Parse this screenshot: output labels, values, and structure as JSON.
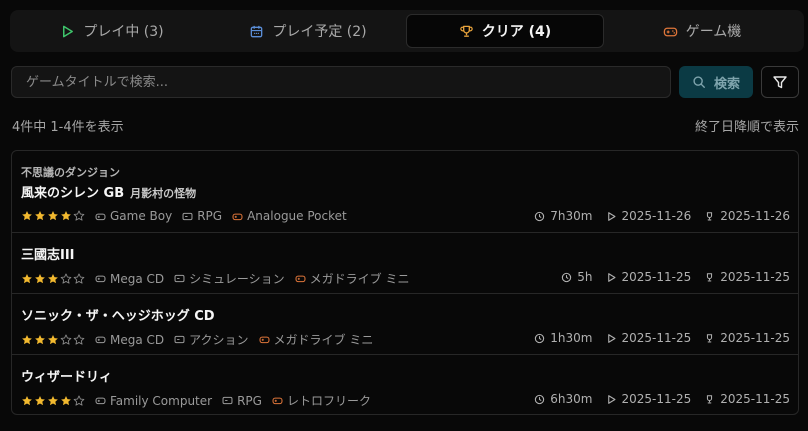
{
  "tabs": [
    {
      "label": "プレイ中 (3)",
      "icon": "play-icon",
      "color": "#3ec56b"
    },
    {
      "label": "プレイ予定 (2)",
      "icon": "calendar-icon",
      "color": "#5b8ed8"
    },
    {
      "label": "クリア (4)",
      "icon": "trophy-icon",
      "color": "#e8a33c",
      "active": true
    },
    {
      "label": "ゲーム機",
      "icon": "gamepad-icon",
      "color": "#e0763a"
    }
  ],
  "search": {
    "placeholder": "ゲームタイトルで検索...",
    "value": "",
    "button_label": "検索"
  },
  "results": {
    "count_text": "4件中 1-4件を表示",
    "sort_label": "終了日降順で表示"
  },
  "colors": {
    "star_filled": "#f2b92f",
    "star_empty": "#8a8a8a",
    "device_icon": "#e0763a",
    "search_button_bg": "#0b3a44"
  },
  "games": [
    {
      "series": "不思議のダンジョン",
      "title": "風来のシレン GB",
      "subtitle": "月影村の怪物",
      "rating": 4,
      "platform": "Game Boy",
      "genre": "RPG",
      "device": "Analogue Pocket",
      "playtime": "7h30m",
      "start_date": "2025-11-26",
      "clear_date": "2025-11-26"
    },
    {
      "series": "",
      "title": "三國志III",
      "subtitle": "",
      "rating": 3,
      "platform": "Mega CD",
      "genre": "シミュレーション",
      "device": "メガドライブ ミニ",
      "playtime": "5h",
      "start_date": "2025-11-25",
      "clear_date": "2025-11-25"
    },
    {
      "series": "",
      "title": "ソニック・ザ・ヘッジホッグ CD",
      "subtitle": "",
      "rating": 3,
      "platform": "Mega CD",
      "genre": "アクション",
      "device": "メガドライブ ミニ",
      "playtime": "1h30m",
      "start_date": "2025-11-25",
      "clear_date": "2025-11-25"
    },
    {
      "series": "",
      "title": "ウィザードリィ",
      "subtitle": "",
      "rating": 4,
      "platform": "Family Computer",
      "genre": "RPG",
      "device": "レトロフリーク",
      "playtime": "6h30m",
      "start_date": "2025-11-25",
      "clear_date": "2025-11-25"
    }
  ]
}
